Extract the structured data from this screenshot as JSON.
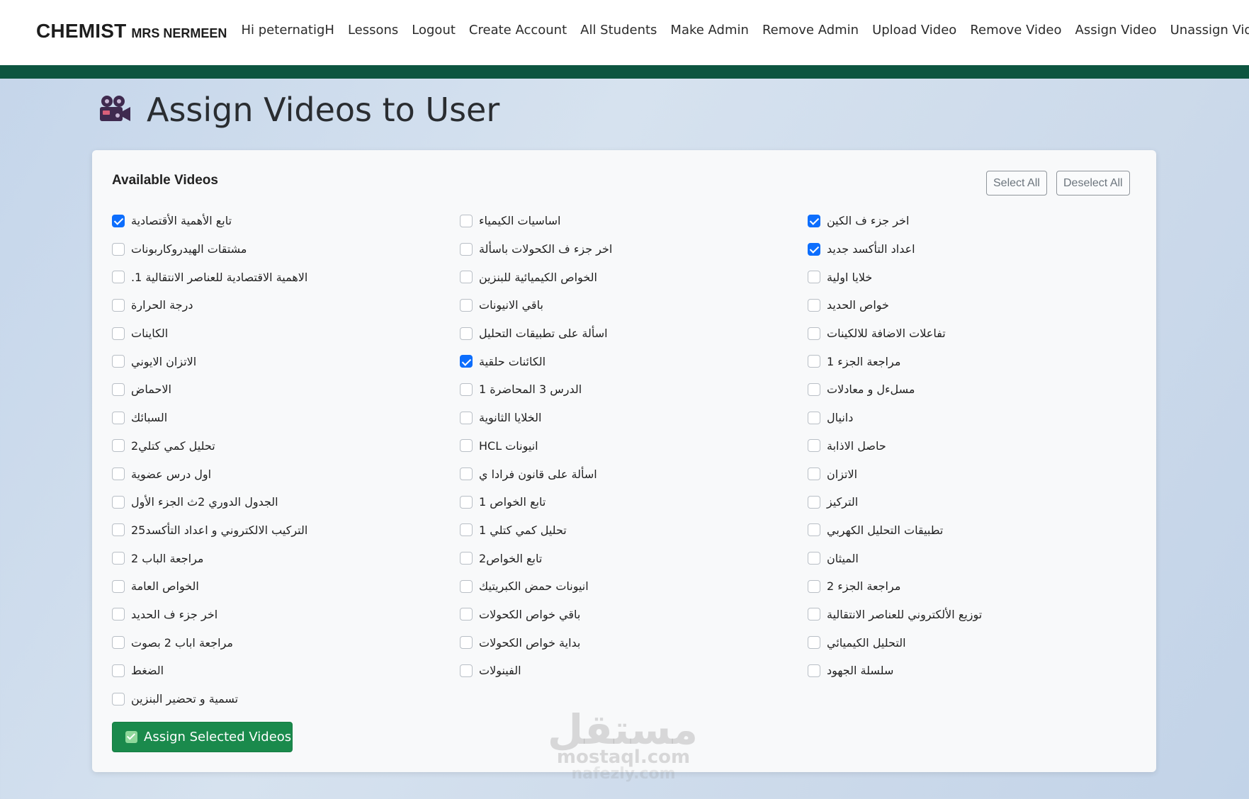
{
  "navbar": {
    "brand": "CHEMIST",
    "brand_sub": "MRS NERMEEN",
    "links": [
      "Hi peternatigH",
      "Lessons",
      "Logout",
      "Create Account",
      "All Students",
      "Make Admin",
      "Remove Admin",
      "Upload Video",
      "Remove Video",
      "Assign Video",
      "Unassign Video"
    ],
    "accent_color": "#0d5540"
  },
  "page": {
    "title": "Assign Videos to User",
    "title_icon": "video-camera-icon"
  },
  "card": {
    "title": "Available Videos",
    "select_all": "Select All",
    "deselect_all": "Deselect All",
    "assign_button": "Assign Selected Videos",
    "assign_color": "#1a8a4c",
    "checkbox_color": "#0d6efd"
  },
  "videos": {
    "col1": [
      {
        "label": "تابع الأهمية الأقتصادية",
        "checked": true
      },
      {
        "label": "مشتقات الهيدروكاربونات",
        "checked": false
      },
      {
        "label": "الاهمية الاقتصادية للعناصر الانتقالية 1.",
        "checked": false
      },
      {
        "label": "درجة الحرارة",
        "checked": false
      },
      {
        "label": "الكاينات",
        "checked": false
      },
      {
        "label": "الاتزان الايوني",
        "checked": false
      },
      {
        "label": "الاحماض",
        "checked": false
      },
      {
        "label": "السبائك",
        "checked": false
      },
      {
        "label": "تحليل كمي كتلي2",
        "checked": false
      },
      {
        "label": "اول درس عضوية",
        "checked": false
      },
      {
        "label": "الجدول الدوري 2ث الجزء الأول",
        "checked": false
      },
      {
        "label": "التركيب الالكتروني و اعداد التأكسد25",
        "checked": false
      },
      {
        "label": "مراجعة الباب 2",
        "checked": false
      },
      {
        "label": "الخواص العامة",
        "checked": false
      },
      {
        "label": "اخر جزء ف الحديد",
        "checked": false
      },
      {
        "label": "مراجعة اباب 2 بصوت",
        "checked": false
      },
      {
        "label": "الضغط",
        "checked": false
      },
      {
        "label": "تسمية و تحضير البنزين",
        "checked": false
      }
    ],
    "col2": [
      {
        "label": "اساسيات الكيمياء",
        "checked": false
      },
      {
        "label": "اخر جزء ف الكحولات باسألة",
        "checked": false
      },
      {
        "label": "الخواص الكيميائية للبنزين",
        "checked": false
      },
      {
        "label": "باقي الانيونات",
        "checked": false
      },
      {
        "label": "اسألة على تطبيقات التحليل",
        "checked": false
      },
      {
        "label": "الكائنات حلقية",
        "checked": true
      },
      {
        "label": "الدرس 3 المحاضرة 1",
        "checked": false
      },
      {
        "label": "الخلايا الثانوية",
        "checked": false
      },
      {
        "label": "انيونات HCL",
        "checked": false
      },
      {
        "label": "اسألة على قانون فرادا ي",
        "checked": false
      },
      {
        "label": "تابع الخواص 1",
        "checked": false
      },
      {
        "label": "تحليل كمي كتلي 1",
        "checked": false
      },
      {
        "label": "تابع الخواص2",
        "checked": false
      },
      {
        "label": "انيونات حمض الكبريتيك",
        "checked": false
      },
      {
        "label": "باقي خواص الكحولات",
        "checked": false
      },
      {
        "label": "بداية خواص الكحولات",
        "checked": false
      },
      {
        "label": "الفينولات",
        "checked": false
      }
    ],
    "col3": [
      {
        "label": "اخر جزء ف الكين",
        "checked": true
      },
      {
        "label": "اعداد التأكسد جديد",
        "checked": true
      },
      {
        "label": "خلايا اولية",
        "checked": false
      },
      {
        "label": "خواص الحديد",
        "checked": false
      },
      {
        "label": "تفاعلات الاضافة للالكينات",
        "checked": false
      },
      {
        "label": "مراجعة الجزء 1",
        "checked": false
      },
      {
        "label": "مسلءل و معادلات",
        "checked": false
      },
      {
        "label": "دانيال",
        "checked": false
      },
      {
        "label": "حاصل الاذابة",
        "checked": false
      },
      {
        "label": "الاتزان",
        "checked": false
      },
      {
        "label": "التركيز",
        "checked": false
      },
      {
        "label": "تطبيقات التحليل الكهربي",
        "checked": false
      },
      {
        "label": "الميثان",
        "checked": false
      },
      {
        "label": "مراجعة الجزء 2",
        "checked": false
      },
      {
        "label": "توزيع الألكتروني للعناصر الانتقالية",
        "checked": false
      },
      {
        "label": "التحليل الكيميائي",
        "checked": false
      },
      {
        "label": "سلسلة الجهود",
        "checked": false
      }
    ]
  },
  "watermark": {
    "arabic": "مستقل",
    "domain": "mostaql.com",
    "domain2": "nafezly.com"
  }
}
